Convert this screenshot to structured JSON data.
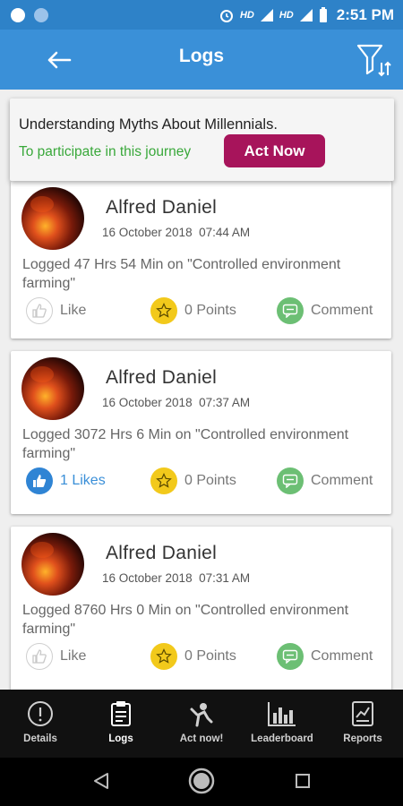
{
  "status_bar": {
    "network_1": "HD",
    "network_2": "HD",
    "time": "2:51 PM"
  },
  "app_bar": {
    "title": "Logs"
  },
  "banner": {
    "title": "Understanding Myths About Millennials.",
    "subtitle": "To participate in this journey",
    "button_label": "Act Now"
  },
  "logs": [
    {
      "name": "Alfred Daniel",
      "date": "16 October 2018",
      "time": "07:44 AM",
      "text": "Logged 47 Hrs 54 Min on \"Controlled environment farming\"",
      "like_label": "Like",
      "liked": false,
      "points_label": "0 Points",
      "comment_label": "Comment"
    },
    {
      "name": "Alfred Daniel",
      "date": "16 October 2018",
      "time": "07:37 AM",
      "text": "Logged 3072 Hrs 6 Min on \"Controlled environment farming\"",
      "like_label": "1 Likes",
      "liked": true,
      "points_label": "0 Points",
      "comment_label": "Comment"
    },
    {
      "name": "Alfred Daniel",
      "date": "16 October 2018",
      "time": "07:31 AM",
      "text": "Logged 8760 Hrs 0 Min on \"Controlled environment farming\"",
      "like_label": "Like",
      "liked": false,
      "points_label": "0 Points",
      "comment_label": "Comment"
    }
  ],
  "bottom_nav": [
    {
      "label": "Details",
      "icon": "info-icon"
    },
    {
      "label": "Logs",
      "icon": "clipboard-icon",
      "active": true
    },
    {
      "label": "Act now!",
      "icon": "person-action-icon"
    },
    {
      "label": "Leaderboard",
      "icon": "bar-chart-icon"
    },
    {
      "label": "Reports",
      "icon": "report-icon"
    }
  ],
  "colors": {
    "app_bar": "#3a90d8",
    "status_bar": "#2e82c8",
    "act_button": "#a7145b",
    "accent_green": "#39a83a",
    "like_active": "#2f84d4"
  }
}
